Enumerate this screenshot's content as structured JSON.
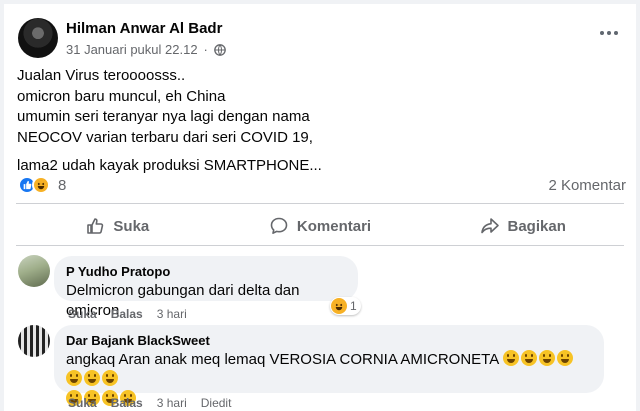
{
  "post": {
    "author": "Hilman Anwar Al Badr",
    "timestamp": "31 Januari pukul 22.12",
    "separator": "·",
    "privacy_icon": "globe-icon",
    "text_lines": [
      "Jualan Virus teroooosss..",
      "omicron baru muncul, eh China",
      "umumin seri teranyar nya lagi dengan nama",
      "NEOCOV varian terbaru dari seri COVID 19,"
    ],
    "text_last": "lama2 udah kayak produksi SMARTPHONE...",
    "reaction_count": "8",
    "reaction_icons": [
      "like-icon",
      "haha-icon"
    ],
    "comment_count": "2 Komentar"
  },
  "actions": {
    "like": "Suka",
    "comment": "Komentari",
    "share": "Bagikan"
  },
  "comments": [
    {
      "name": "P Yudho Pratopo",
      "text": "Delmicron gabungan dari delta dan omicron",
      "reaction_count": "1",
      "like": "Suka",
      "reply": "Balas",
      "time": "3 hari"
    },
    {
      "name": "Dar Bajank BlackSweet",
      "text": "angkaq Aran anak meq lemaq VEROSIA CORNIA AMICRONETA",
      "emoji_count_line1": 7,
      "emoji_count_line2": 4,
      "emoji_name": "grinning-face-emoji",
      "like": "Suka",
      "reply": "Balas",
      "time": "3 hari",
      "edited": "Diedit"
    }
  ],
  "colors": {
    "background": "#f0f2f5",
    "card": "#ffffff",
    "secondary_text": "#65676b",
    "like_blue": "#1877f2",
    "haha_yellow": "#f7b125"
  }
}
